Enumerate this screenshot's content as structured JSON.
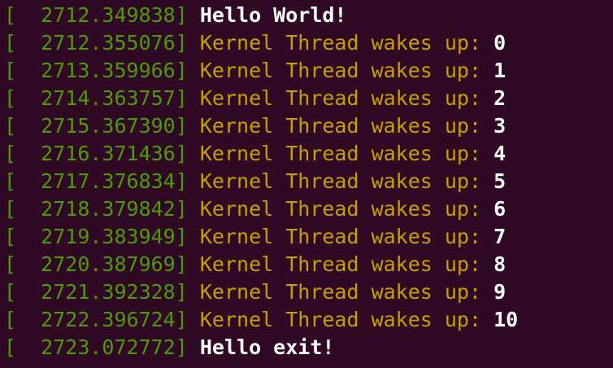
{
  "terminal": {
    "lines": [
      {
        "timestamp": "2712.349838",
        "message": "Hello World!",
        "kind": "plain",
        "value": ""
      },
      {
        "timestamp": "2712.355076",
        "message": "Kernel Thread wakes up:",
        "kind": "kthread",
        "value": "0"
      },
      {
        "timestamp": "2713.359966",
        "message": "Kernel Thread wakes up:",
        "kind": "kthread",
        "value": "1"
      },
      {
        "timestamp": "2714.363757",
        "message": "Kernel Thread wakes up:",
        "kind": "kthread",
        "value": "2"
      },
      {
        "timestamp": "2715.367390",
        "message": "Kernel Thread wakes up:",
        "kind": "kthread",
        "value": "3"
      },
      {
        "timestamp": "2716.371436",
        "message": "Kernel Thread wakes up:",
        "kind": "kthread",
        "value": "4"
      },
      {
        "timestamp": "2717.376834",
        "message": "Kernel Thread wakes up:",
        "kind": "kthread",
        "value": "5"
      },
      {
        "timestamp": "2718.379842",
        "message": "Kernel Thread wakes up:",
        "kind": "kthread",
        "value": "6"
      },
      {
        "timestamp": "2719.383949",
        "message": "Kernel Thread wakes up:",
        "kind": "kthread",
        "value": "7"
      },
      {
        "timestamp": "2720.387969",
        "message": "Kernel Thread wakes up:",
        "kind": "kthread",
        "value": "8"
      },
      {
        "timestamp": "2721.392328",
        "message": "Kernel Thread wakes up:",
        "kind": "kthread",
        "value": "9"
      },
      {
        "timestamp": "2722.396724",
        "message": "Kernel Thread wakes up:",
        "kind": "kthread",
        "value": "10"
      },
      {
        "timestamp": "2723.072772",
        "message": "Hello exit!",
        "kind": "plain",
        "value": ""
      }
    ],
    "colors": {
      "background": "#300a24",
      "timestamp": "#4e9a06",
      "kthread_message": "#c4a000",
      "plain_message": "#ffffff"
    }
  }
}
